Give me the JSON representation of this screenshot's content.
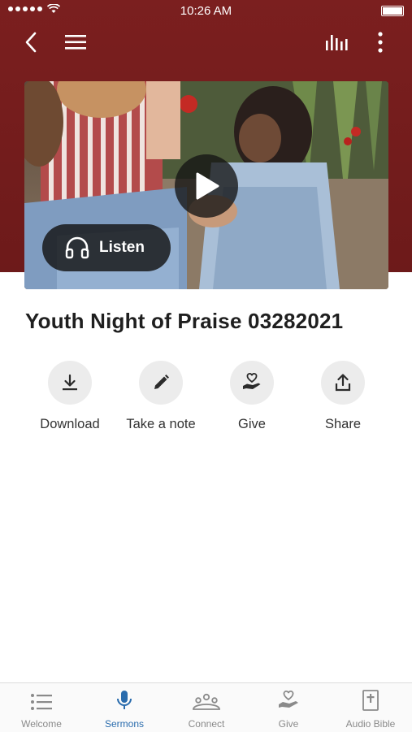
{
  "status_bar": {
    "time": "10:26 AM"
  },
  "media": {
    "listen_label": "Listen"
  },
  "sermon": {
    "title": "Youth Night of Praise 03282021"
  },
  "actions": [
    {
      "label": "Download",
      "icon": "download-icon"
    },
    {
      "label": "Take a note",
      "icon": "pencil-icon"
    },
    {
      "label": "Give",
      "icon": "give-heart-hand-icon"
    },
    {
      "label": "Share",
      "icon": "share-upload-icon"
    }
  ],
  "tabs": [
    {
      "label": "Welcome",
      "icon": "list-icon",
      "active": false
    },
    {
      "label": "Sermons",
      "icon": "microphone-icon",
      "active": true
    },
    {
      "label": "Connect",
      "icon": "people-icon",
      "active": false
    },
    {
      "label": "Give",
      "icon": "give-heart-hand-icon",
      "active": false
    },
    {
      "label": "Audio Bible",
      "icon": "bible-icon",
      "active": false
    }
  ],
  "colors": {
    "header": "#7b1f1f",
    "active_tab": "#2a6cad",
    "inactive_tab": "#8a8a8a"
  }
}
